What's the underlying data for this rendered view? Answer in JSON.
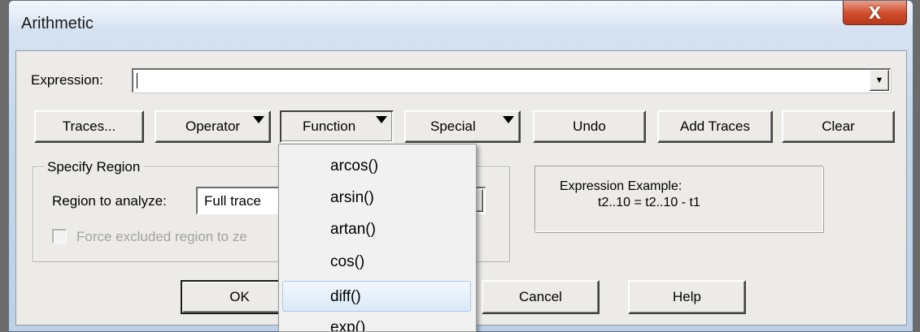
{
  "window": {
    "title": "Arithmetic",
    "close_glyph": "X"
  },
  "expression": {
    "label": "Expression:",
    "value": ""
  },
  "toolbar": {
    "traces": "Traces...",
    "operator": "Operator",
    "function": "Function",
    "special": "Special",
    "undo": "Undo",
    "add_traces": "Add Traces",
    "clear": "Clear"
  },
  "region": {
    "group_label": "Specify Region",
    "analyze_label": "Region to analyze:",
    "selected": "Full trace",
    "force_label": "Force excluded region to ze",
    "force_checked": false,
    "force_enabled": false
  },
  "example": {
    "title": "Expression Example:",
    "text": "t2..10 = t2..10 - t1"
  },
  "dialog_buttons": {
    "ok": "OK",
    "cancel": "Cancel",
    "help": "Help"
  },
  "function_menu": {
    "items": [
      "arcos()",
      "arsin()",
      "artan()",
      "cos()",
      "diff()",
      "exp()"
    ],
    "highlighted_index": 4
  },
  "colors": {
    "dialog_face": "#ecebe8",
    "menu_highlight": "#dbe9f9",
    "close_button": "#d2502f"
  }
}
